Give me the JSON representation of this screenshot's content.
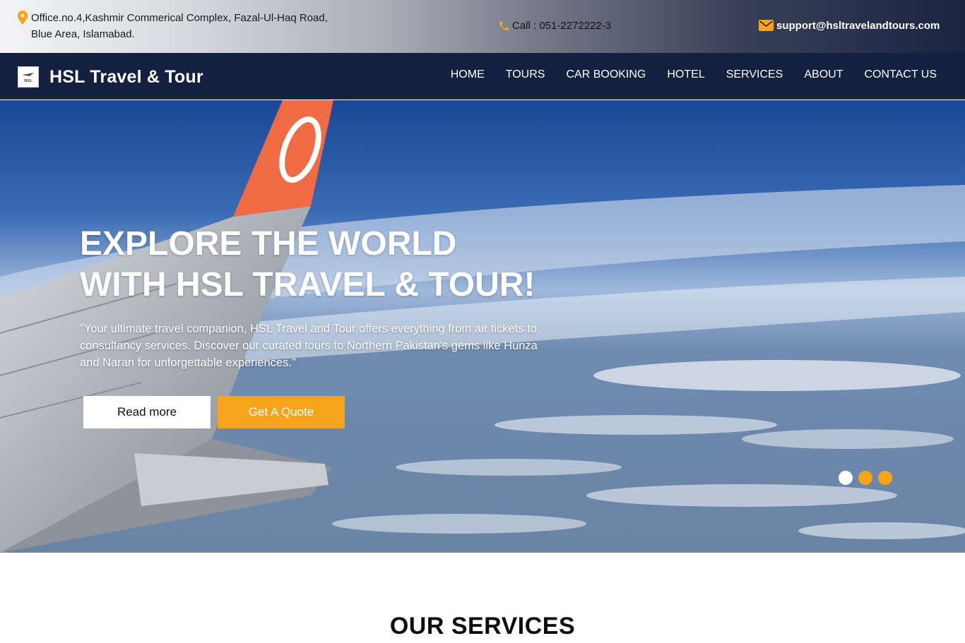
{
  "topbar": {
    "address_line1": "Office.no.4,Kashmir Commerical Complex, Fazal-Ul-Haq Road,",
    "address_line2": "Blue Area, Islamabad.",
    "phone": "Call : 051-2272222-3",
    "email": "support@hsltravelandtours.com",
    "icons": {
      "address": "map-pin-icon",
      "phone": "phone-icon",
      "email": "envelope-icon"
    },
    "icon_color": "#f7a41d"
  },
  "nav": {
    "brand_logo_text": "HSL",
    "brand_name": "HSL Travel & Tour",
    "links": [
      "HOME",
      "TOURS",
      "CAR BOOKING",
      "HOTEL",
      "SERVICES",
      "ABOUT",
      "CONTACT US"
    ],
    "background": "#14203f"
  },
  "hero": {
    "title_line1": "EXPLORE THE WORLD",
    "title_line2": "WITH HSL TRAVEL & TOUR!",
    "description": "\"Your ultimate travel companion, HSL Travel and Tour offers everything from air tickets to consultancy services. Discover our curated tours to Northern Pakistan's gems like Hunza and Naran for unforgettable experiences.\"",
    "buttons": {
      "read_more": "Read more",
      "get_quote": "Get A Quote"
    },
    "slides": {
      "count": 3,
      "active_index": 0
    },
    "accent": "#f7a41d"
  },
  "services": {
    "title": "OUR SERVICES"
  }
}
